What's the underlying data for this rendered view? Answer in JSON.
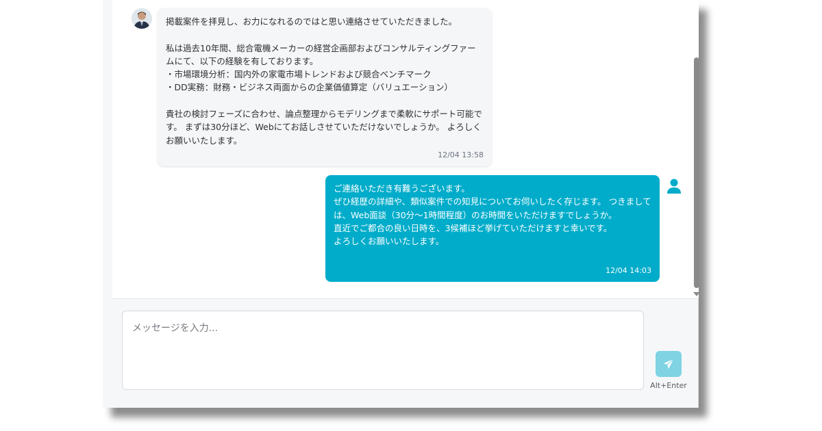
{
  "conversation": {
    "incoming": {
      "text": "掲載案件を拝見し、お力になれるのではと思い連絡させていただきました。\n\n私は過去10年間、総合電機メーカーの経営企画部およびコンサルティングファームにて、以下の経験を有しております。\n・市場環境分析：国内外の家電市場トレンドおよび競合ベンチマーク\n・DD実務：財務・ビジネス両面からの企業価値算定（バリュエーション）\n\n貴社の検討フェーズに合わせ、論点整理からモデリングまで柔軟にサポート可能です。 まずは30分ほど、Webにてお話しさせていただけないでしょうか。 よろしくお願いいたします。",
      "time": "12/04 13:58"
    },
    "outgoing": {
      "text": "ご連絡いただき有難うございます。\nぜひ経歴の詳細や、類似案件での知見についてお伺いしたく存じます。 つきましては、Web面談（30分〜1時間程度）のお時間をいただけますでしょうか。\n直近でご都合の良い日時を、3候補ほど挙げていただけますと幸いです。\nよろしくお願いいたします。",
      "time": "12/04 14:03"
    }
  },
  "composer": {
    "placeholder": "メッセージを入力...",
    "send_hint": "Alt+Enter"
  },
  "icons": {
    "send": "paper-plane-icon",
    "user": "user-icon"
  },
  "colors": {
    "accent": "#00acca",
    "send_button": "#7fd3e3"
  }
}
